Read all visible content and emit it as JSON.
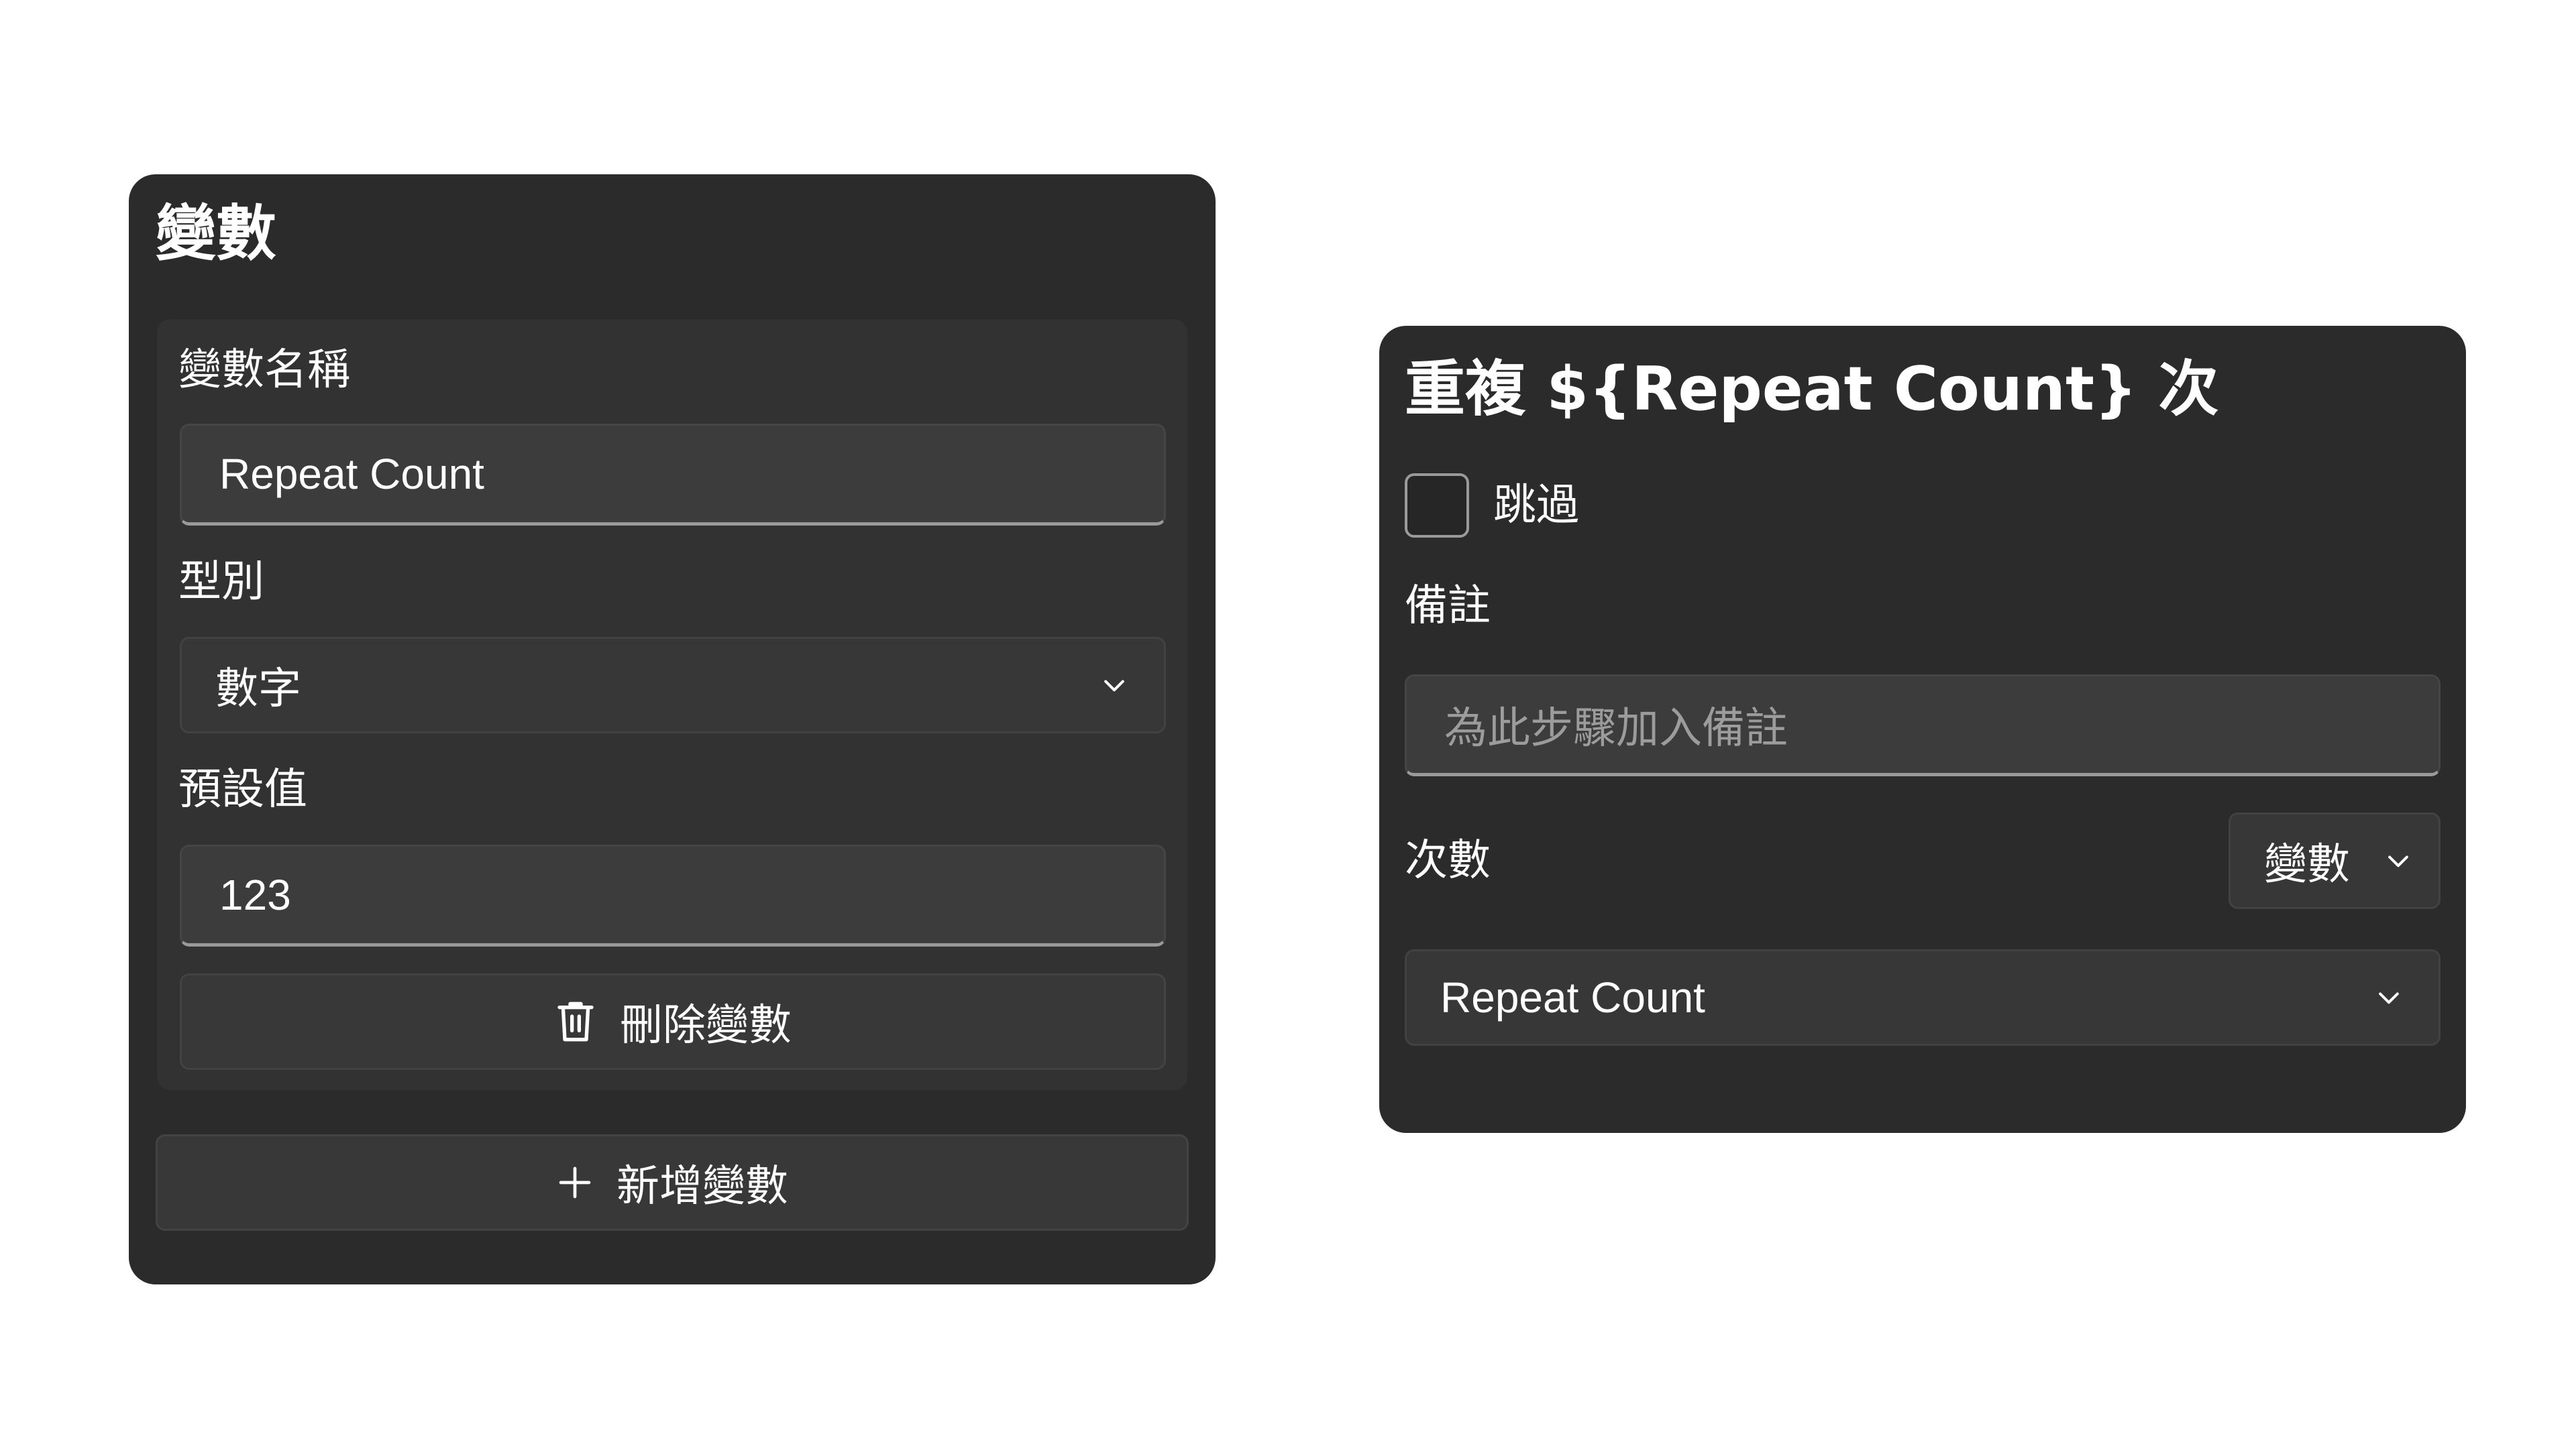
{
  "variables_panel": {
    "title": "變數",
    "variable": {
      "name_label": "變數名稱",
      "name_value": "Repeat Count",
      "type_label": "型別",
      "type_value": "數字",
      "default_label": "預設值",
      "default_value": "123",
      "delete_label": "刪除變數"
    },
    "add_label": "新增變數"
  },
  "repeat_panel": {
    "title": "重複 ${Repeat Count} 次",
    "skip_label": "跳過",
    "skip_checked": false,
    "note_label": "備註",
    "note_placeholder": "為此步驟加入備註",
    "count_label": "次數",
    "count_mode": "變數",
    "count_variable": "Repeat Count"
  },
  "icons": [
    "chevron-down-icon",
    "trash-icon",
    "plus-icon"
  ],
  "colors": {
    "panel_bg": "#2b2b2b",
    "card_bg": "#323232",
    "control_bg": "#3c3c3c",
    "text": "#ffffff",
    "placeholder": "#9c9c9c"
  }
}
